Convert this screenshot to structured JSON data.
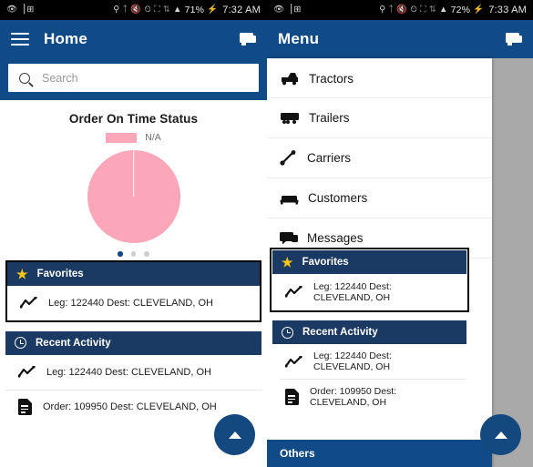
{
  "left": {
    "statusbar": {
      "icons_left": [
        "eye-icon",
        "screenshot-icon"
      ],
      "icons_right": [
        "location-icon",
        "bluetooth-icon",
        "mute-icon",
        "alarm-icon",
        "cast-icon",
        "sync-icon",
        "signal-icon"
      ],
      "battery": "71%",
      "time": "7:32 AM"
    },
    "appbar": {
      "title": "Home",
      "menu_icon": "hamburger-icon",
      "chat_icon": "chat-icon"
    },
    "search": {
      "placeholder": "Search",
      "icon": "search-icon"
    },
    "chart_data": {
      "type": "pie",
      "title": "Order On Time Status",
      "categories": [
        "N/A"
      ],
      "values": [
        100
      ],
      "colors": [
        "#fba7b9"
      ],
      "legend": [
        "N/A"
      ],
      "legend_position": "top",
      "labels_shown": false
    },
    "carousel": {
      "total": 3,
      "active": 1
    },
    "favorites": {
      "title": "Favorites",
      "icon": "star-icon",
      "items": [
        {
          "icon": "leg-chart-icon",
          "label": "Leg: 122440 Dest: CLEVELAND, OH"
        }
      ]
    },
    "recent_activity": {
      "title": "Recent Activity",
      "icon": "clock-icon",
      "items": [
        {
          "icon": "leg-chart-icon",
          "label": "Leg: 122440 Dest: CLEVELAND, OH"
        },
        {
          "icon": "document-icon",
          "label": "Order: 109950 Dest: CLEVELAND, OH"
        }
      ]
    },
    "fab": {
      "icon": "arrow-up-icon"
    }
  },
  "right": {
    "statusbar": {
      "battery": "72%",
      "time": "7:33 AM"
    },
    "appbar": {
      "title": "Menu",
      "chat_icon": "chat-icon"
    },
    "menu": {
      "items": [
        {
          "icon": "tractor-icon",
          "label": "Tractors"
        },
        {
          "icon": "trailer-icon",
          "label": "Trailers"
        },
        {
          "icon": "carrier-icon",
          "label": "Carriers"
        },
        {
          "icon": "customer-icon",
          "label": "Customers"
        },
        {
          "icon": "message-icon",
          "label": "Messages"
        }
      ],
      "footer": {
        "label": "Others"
      }
    },
    "favorites": {
      "title": "Favorites",
      "icon": "star-icon",
      "items": [
        {
          "icon": "leg-chart-icon",
          "label": "Leg: 122440 Dest: CLEVELAND, OH"
        }
      ]
    },
    "recent_activity": {
      "title": "Recent Activity",
      "icon": "clock-icon",
      "items": [
        {
          "icon": "leg-chart-icon",
          "label": "Leg: 122440 Dest: CLEVELAND, OH"
        },
        {
          "icon": "document-icon",
          "label": "Order: 109950 Dest: CLEVELAND, OH"
        }
      ]
    },
    "fab": {
      "icon": "arrow-up-icon"
    }
  },
  "colors": {
    "appbar_blue": "#104a87",
    "section_navy": "#1b3a63",
    "pie_pink": "#fba7b9",
    "star_yellow": "#f5c518",
    "scrim_grey": "#a9a9a9",
    "highlight_border": "#000000"
  }
}
